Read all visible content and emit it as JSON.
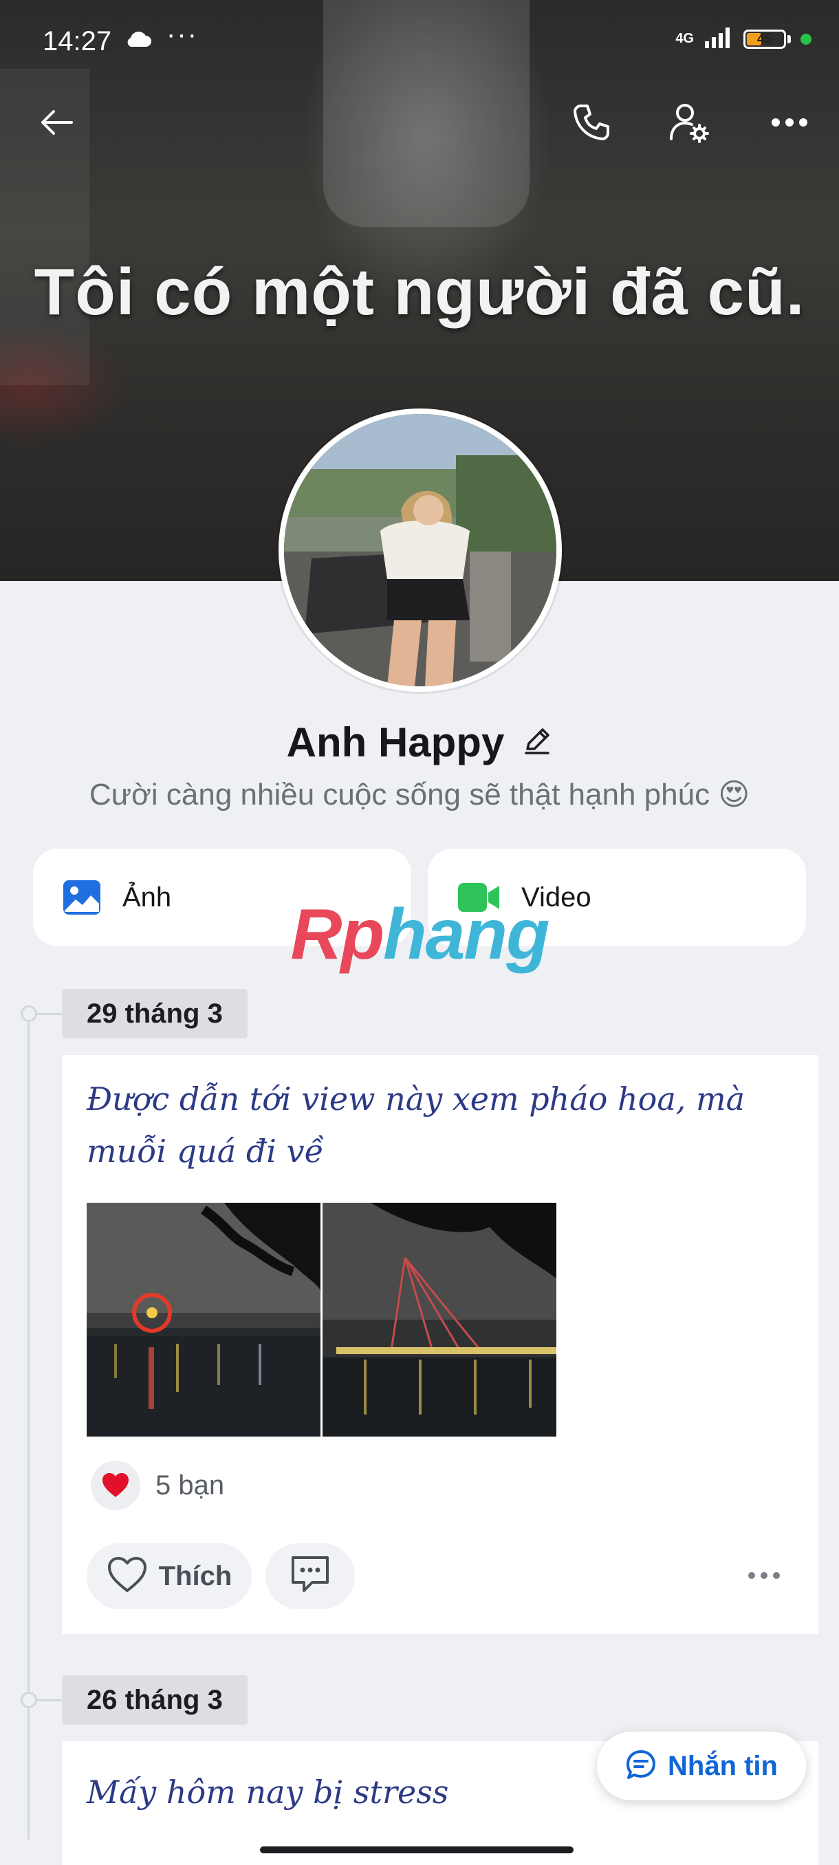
{
  "status_bar": {
    "time": "14:27",
    "network": "4G",
    "battery": "45",
    "battery_level": 0.45,
    "icons": [
      "cloud-icon",
      "more-dots-icon",
      "signal-icon",
      "battery-icon"
    ]
  },
  "cover": {
    "text": "Tôi có một người đã cũ."
  },
  "topnav": {
    "icons": [
      "back-arrow-icon",
      "phone-icon",
      "user-settings-icon",
      "more-icon"
    ]
  },
  "profile": {
    "name": "Anh Happy",
    "bio": "Cười càng nhiều cuộc sống sẽ thật hạnh phúc 😍"
  },
  "media_tabs": [
    {
      "label": "Ảnh",
      "icon": "photo-icon"
    },
    {
      "label": "Video",
      "icon": "video-camera-icon"
    }
  ],
  "watermark": {
    "part1": "Rp",
    "part2": "hang"
  },
  "posts": [
    {
      "date": "29 tháng 3",
      "text": "Được dẫn tới view này xem pháo hoa, mà muỗi quá đi về",
      "photos": [
        "night-river-ferris-wheel",
        "night-river-bridge"
      ],
      "reaction_count": "5 bạn",
      "like_label": "Thích"
    },
    {
      "date": "26 tháng 3",
      "text": "Mấy hôm nay bị stress"
    }
  ],
  "message_button": {
    "label": "Nhắn tin"
  },
  "colors": {
    "accent": "#1066d6",
    "post_text": "#2c3a86",
    "video_icon": "#2fc45a",
    "photo_icon": "#1f6fe0"
  }
}
